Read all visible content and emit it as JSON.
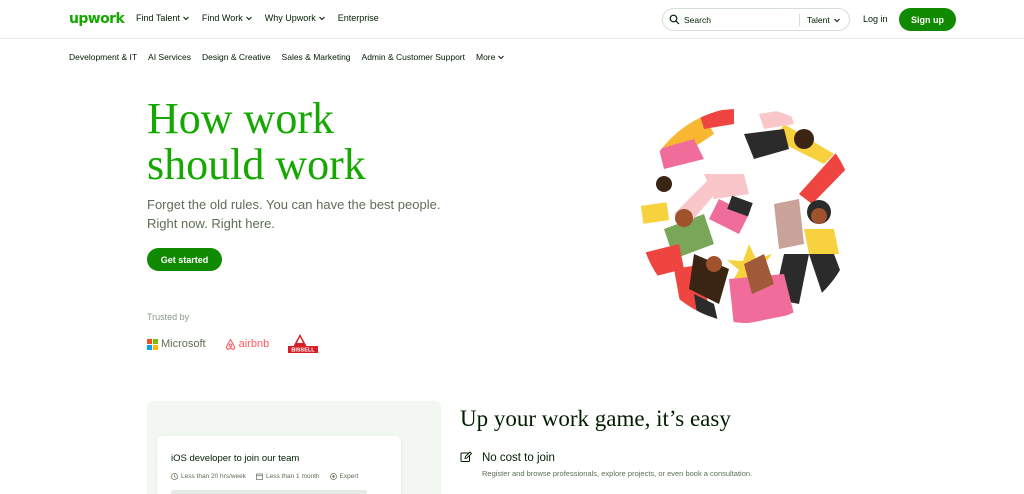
{
  "brand": {
    "logo": "upwork",
    "accent": "#14a800",
    "button_green": "#108a00"
  },
  "nav": {
    "links": [
      {
        "label": "Find Talent",
        "dropdown": true
      },
      {
        "label": "Find Work",
        "dropdown": true
      },
      {
        "label": "Why Upwork",
        "dropdown": true
      },
      {
        "label": "Enterprise",
        "dropdown": false
      }
    ],
    "search": {
      "placeholder": "Search",
      "category": "Talent",
      "icon": "search-icon"
    },
    "login": "Log in",
    "signup": "Sign up"
  },
  "categories": [
    "Development & IT",
    "AI Services",
    "Design & Creative",
    "Sales & Marketing",
    "Admin & Customer Support",
    "More"
  ],
  "hero": {
    "title_line1": "How work",
    "title_line2": "should work",
    "subtitle_line1": "Forget the old rules. You can have the best people.",
    "subtitle_line2": "Right now. Right here.",
    "cta": "Get started",
    "trusted_by": "Trusted by",
    "logos": {
      "microsoft": "Microsoft",
      "airbnb": "airbnb",
      "bissell": "BISSELL"
    }
  },
  "lower": {
    "job_card": {
      "title": "iOS developer to join our team",
      "tags": [
        "Less than 20 hrs/week",
        "Less than 1 month",
        "Expert"
      ]
    },
    "section_title": "Up your work game, it’s easy",
    "feature": {
      "title": "No cost to join",
      "description": "Register and browse professionals, explore projects, or even book a consultation.",
      "icon": "edit-icon"
    }
  }
}
